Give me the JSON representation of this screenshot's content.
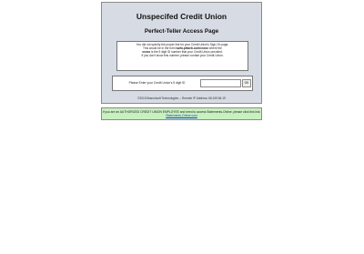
{
  "header": {
    "title": "Unspecifed Credit Union",
    "subtitle": "Perfect-Teller Access Page"
  },
  "message": {
    "line1": "You did not specify the proper link for your Credit Union's Sign-On page.",
    "line2_pre": "This would be in the form ",
    "line2_bold": "www.ptiweb.com/xxxxx",
    "line2_post": " where the",
    "line3_bold": "xxxxx",
    "line3_post": " is the 5 digit ID number that your Credit Union provided.",
    "line4": "If you don't know this number, please contact your Credit Union."
  },
  "form": {
    "label": "Please Enter your Credit Union's 5 digit ID",
    "input_value": "",
    "ok_label": "OK"
  },
  "footer": {
    "text": "©2015 Branchsoft Technologies -- Remote IP Address: 66.249.84.19"
  },
  "notice": {
    "text": "If you are an AUTHORIZED CREDIT UNION EMPLOYEE and need to access Statements-Online, please click this link: ",
    "link_text": "Statements-Online.com"
  },
  "colors": {
    "panel_bg": "#d6dbe4",
    "notice_bg": "#c8f0c0",
    "link": "#1a3fcc"
  }
}
